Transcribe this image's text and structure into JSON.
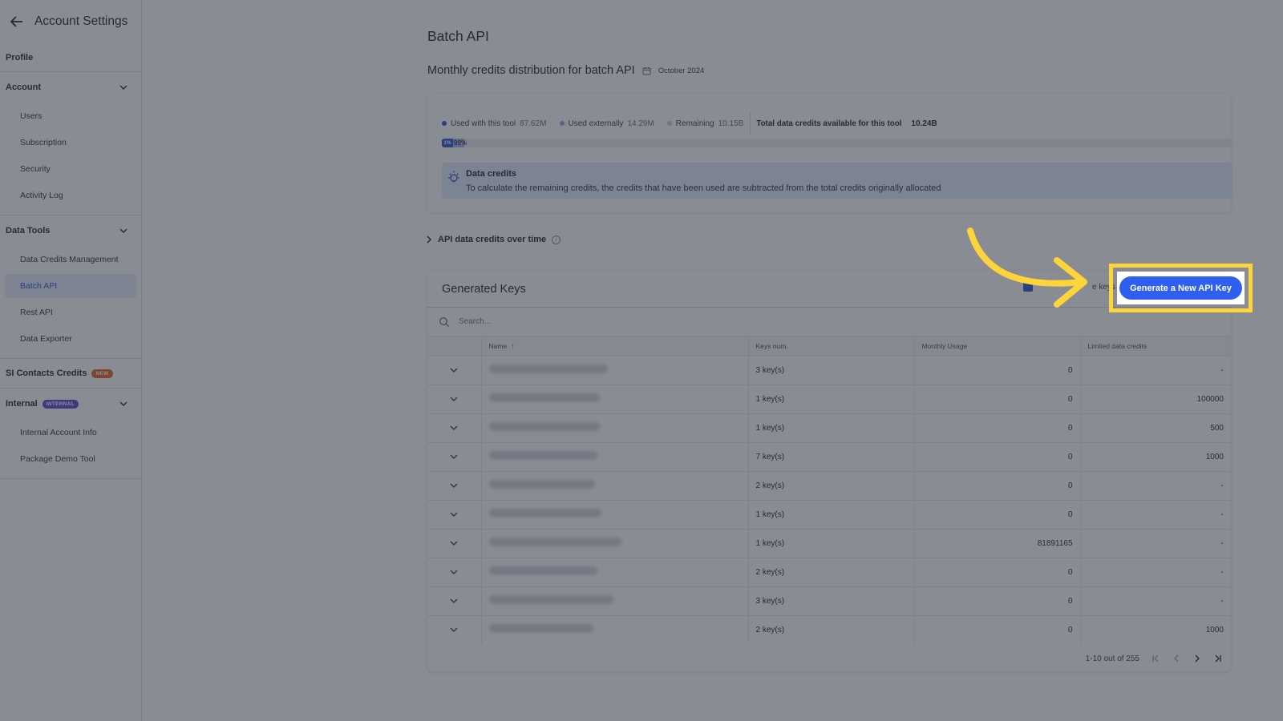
{
  "sidebar": {
    "title": "Account Settings",
    "profile_label": "Profile",
    "groups": [
      {
        "label": "Account",
        "items": [
          "Users",
          "Subscription",
          "Security",
          "Activity Log"
        ]
      },
      {
        "label": "Data Tools",
        "items": [
          "Data Credits Management",
          "Batch API",
          "Rest API",
          "Data Exporter"
        ]
      }
    ],
    "si_contacts": {
      "label": "SI Contacts Credits",
      "badge": "NEW"
    },
    "internal": {
      "label": "Internal",
      "badge": "INTERNAL",
      "items": [
        "Internal Account Info",
        "Package Demo Tool"
      ]
    },
    "active_item": "Batch API"
  },
  "page": {
    "title": "Batch API",
    "credits_title": "Monthly credits distribution for batch API",
    "period": "October 2024"
  },
  "credits": {
    "legend": [
      {
        "label": "Used with this tool",
        "value": "87.62M",
        "color": "#2a54d6"
      },
      {
        "label": "Used externally",
        "value": "14.29M",
        "color": "#8fa6e0"
      },
      {
        "label": "Remaining",
        "value": "10.15B",
        "color": "#c9ccd4"
      }
    ],
    "total_label": "Total data credits available for this tool",
    "total_value": "10.24B",
    "bar": {
      "used_tool_label": "1%",
      "used_external_label": "1%",
      "remaining_label": "99%",
      "used_tool_pct": 1,
      "used_external_pct": 1
    },
    "info_title": "Data credits",
    "info_text": "To calculate the remaining credits, the credits that have been used are subtracted from the total credits originally allocated"
  },
  "overtime_label": "API data credits over time",
  "keys": {
    "title": "Generated Keys",
    "hidden_toggle_label": "e keys",
    "generate_label": "Generate a New API Key",
    "search_placeholder": "Search...",
    "columns": [
      "Name",
      "Keys num.",
      "Monthly Usage",
      "Limited data credits"
    ],
    "rows": [
      {
        "keys": "3 key(s)",
        "usage": "0",
        "limit": "-"
      },
      {
        "keys": "1 key(s)",
        "usage": "0",
        "limit": "100000"
      },
      {
        "keys": "1 key(s)",
        "usage": "0",
        "limit": "500"
      },
      {
        "keys": "7 key(s)",
        "usage": "0",
        "limit": "1000"
      },
      {
        "keys": "2 key(s)",
        "usage": "0",
        "limit": "-"
      },
      {
        "keys": "1 key(s)",
        "usage": "0",
        "limit": "-"
      },
      {
        "keys": "1 key(s)",
        "usage": "81891165",
        "limit": "-"
      },
      {
        "keys": "2 key(s)",
        "usage": "0",
        "limit": "-"
      },
      {
        "keys": "3 key(s)",
        "usage": "0",
        "limit": "-"
      },
      {
        "keys": "2 key(s)",
        "usage": "0",
        "limit": "1000"
      }
    ],
    "pagination": "1-10 out of 255"
  }
}
